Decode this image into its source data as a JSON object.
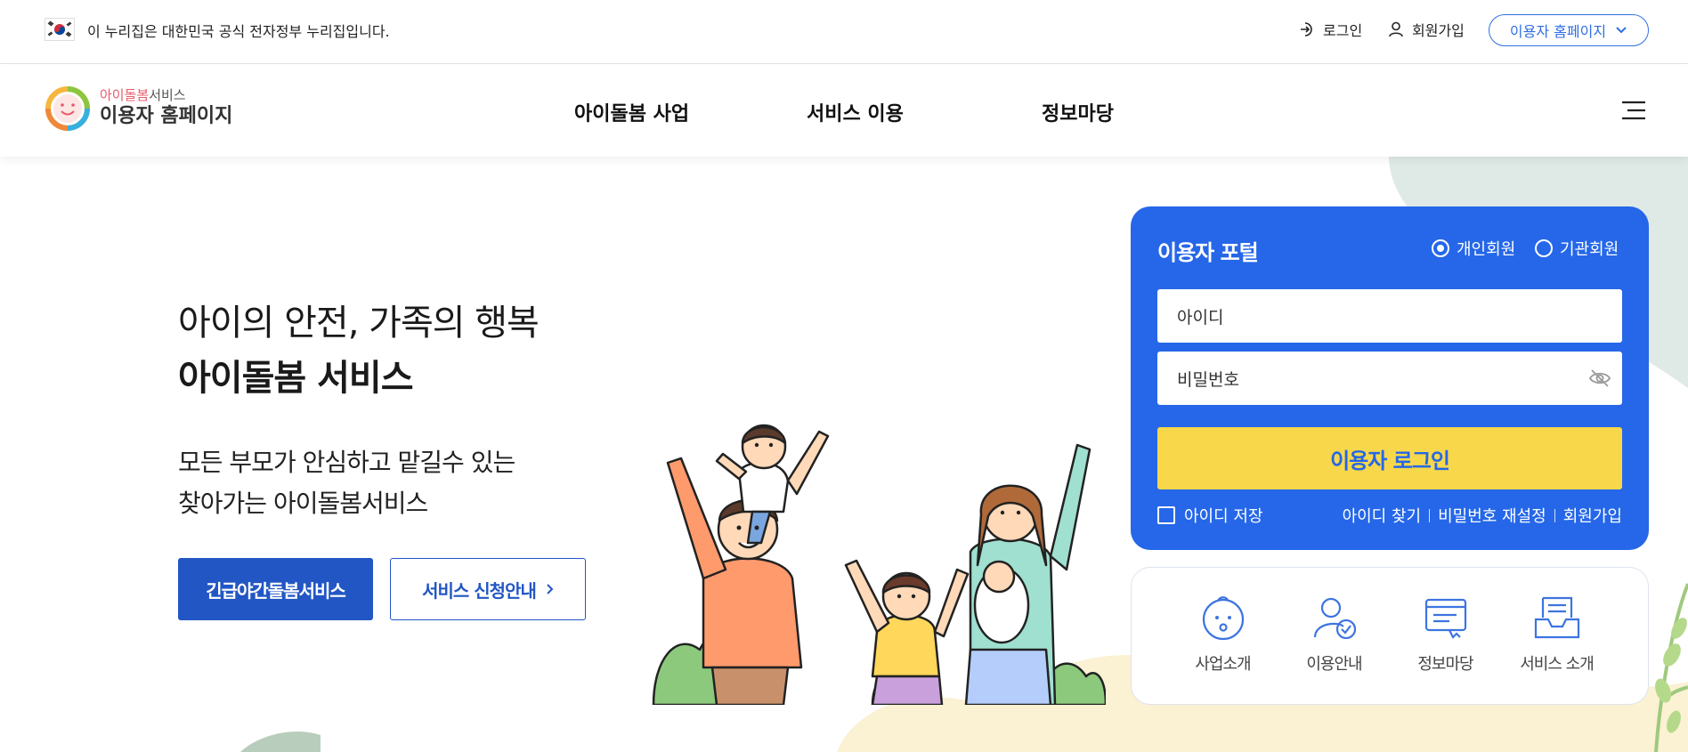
{
  "gov_bar": {
    "text": "이 누리집은 대한민국 공식 전자정부 누리집입니다.",
    "login": "로그인",
    "join": "회원가입",
    "site_select": "이용자 홈페이지"
  },
  "header": {
    "logo_sub_pink": "아이돌봄",
    "logo_sub_rest": "서비스",
    "logo_title": "이용자 홈페이지",
    "nav": [
      "아이돌봄 사업",
      "서비스 이용",
      "정보마당"
    ]
  },
  "hero": {
    "line1": "아이의 안전, 가족의 행복",
    "line2": "아이돌봄 서비스",
    "desc1": "모든 부모가 안심하고 맡길수 있는",
    "desc2": "찾아가는 아이돌봄서비스",
    "btn_primary": "긴급야간돌봄서비스",
    "btn_outline": "서비스 신청안내"
  },
  "portal": {
    "title": "이용자 포털",
    "radio_personal": "개인회원",
    "radio_org": "기관회원",
    "selected_member_type": "개인회원",
    "id_placeholder": "아이디",
    "pw_placeholder": "비밀번호",
    "login_button": "이용자 로그인",
    "save_id": "아이디 저장",
    "find_id": "아이디 찾기",
    "reset_pw": "비밀번호 재설정",
    "join": "회원가입"
  },
  "quick_menu": [
    {
      "label": "사업소개",
      "icon": "baby-face-icon"
    },
    {
      "label": "이용안내",
      "icon": "user-check-icon"
    },
    {
      "label": "정보마당",
      "icon": "document-icon"
    },
    {
      "label": "서비스 소개",
      "icon": "inbox-tray-icon"
    }
  ],
  "colors": {
    "primary_blue": "#2567e8",
    "button_blue": "#2256c4",
    "login_yellow": "#f8d84a"
  }
}
